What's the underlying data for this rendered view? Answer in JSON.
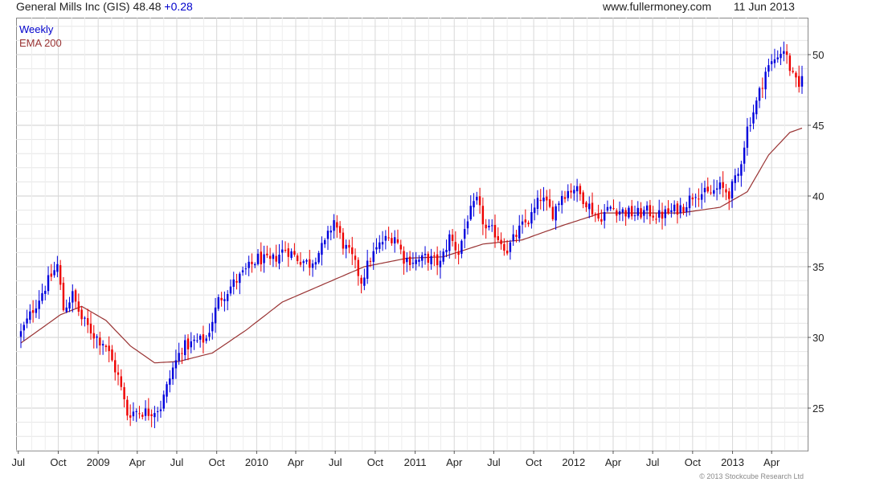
{
  "header": {
    "company": "General Mills Inc (GIS)",
    "price": "48.48",
    "change": "+0.28",
    "site": "www.fullermoney.com",
    "date": "11 Jun 2013"
  },
  "legend": {
    "interval": "Weekly",
    "ema": "EMA 200"
  },
  "footer": "© 2013 Stockcube Research Ltd",
  "colors": {
    "up": "#0000dd",
    "down": "#ee0000",
    "ema": "#993333",
    "grid": "#e6e6e6",
    "axis": "#555555"
  },
  "chart_data": {
    "type": "candlestick",
    "interval": "weekly",
    "x_range": [
      "2008-07-07",
      "2013-06-10"
    ],
    "ylim": [
      22,
      52
    ],
    "y_ticks": [
      25,
      30,
      35,
      40,
      45,
      50
    ],
    "x_tick_labels": [
      "Jul",
      "Oct",
      "2009",
      "Apr",
      "Jul",
      "Oct",
      "2010",
      "Apr",
      "Jul",
      "Oct",
      "2011",
      "Apr",
      "Jul",
      "Oct",
      "2012",
      "Apr",
      "Jul",
      "Oct",
      "2013",
      "Apr"
    ],
    "x_tick_dates": [
      "2008-07-01",
      "2008-10-01",
      "2009-01-01",
      "2009-04-01",
      "2009-07-01",
      "2009-10-01",
      "2010-01-01",
      "2010-04-01",
      "2010-07-01",
      "2010-10-01",
      "2011-01-01",
      "2011-04-01",
      "2011-07-01",
      "2011-10-01",
      "2012-01-01",
      "2012-04-01",
      "2012-07-01",
      "2012-10-01",
      "2013-01-01",
      "2013-04-01"
    ],
    "close_keypoints": [
      [
        "2008-07-07",
        30.3
      ],
      [
        "2008-08-04",
        32.0
      ],
      [
        "2008-09-01",
        33.6
      ],
      [
        "2008-09-29",
        35.1
      ],
      [
        "2008-10-13",
        32.0
      ],
      [
        "2008-11-03",
        33.0
      ],
      [
        "2008-11-24",
        31.3
      ],
      [
        "2008-12-22",
        30.2
      ],
      [
        "2009-01-19",
        29.4
      ],
      [
        "2009-02-16",
        27.2
      ],
      [
        "2009-03-09",
        24.6
      ],
      [
        "2009-03-30",
        24.8
      ],
      [
        "2009-04-27",
        24.7
      ],
      [
        "2009-05-25",
        25.1
      ],
      [
        "2009-06-22",
        27.8
      ],
      [
        "2009-07-13",
        29.3
      ],
      [
        "2009-08-10",
        29.6
      ],
      [
        "2009-09-07",
        29.9
      ],
      [
        "2009-10-05",
        32.6
      ],
      [
        "2009-11-02",
        33.6
      ],
      [
        "2009-12-07",
        34.7
      ],
      [
        "2010-01-04",
        35.6
      ],
      [
        "2010-02-01",
        35.3
      ],
      [
        "2010-03-08",
        36.3
      ],
      [
        "2010-04-05",
        35.6
      ],
      [
        "2010-05-03",
        35.2
      ],
      [
        "2010-06-07",
        36.6
      ],
      [
        "2010-06-28",
        38.3
      ],
      [
        "2010-07-19",
        36.6
      ],
      [
        "2010-08-09",
        35.6
      ],
      [
        "2010-08-30",
        34.0
      ],
      [
        "2010-09-20",
        35.6
      ],
      [
        "2010-10-18",
        36.8
      ],
      [
        "2010-11-15",
        37.2
      ],
      [
        "2010-12-06",
        35.6
      ],
      [
        "2011-01-03",
        35.4
      ],
      [
        "2011-01-31",
        35.6
      ],
      [
        "2011-02-28",
        35.2
      ],
      [
        "2011-03-21",
        37.1
      ],
      [
        "2011-04-11",
        36.0
      ],
      [
        "2011-05-02",
        38.5
      ],
      [
        "2011-05-23",
        39.6
      ],
      [
        "2011-06-13",
        37.6
      ],
      [
        "2011-07-04",
        37.4
      ],
      [
        "2011-08-01",
        36.2
      ],
      [
        "2011-08-29",
        37.6
      ],
      [
        "2011-09-26",
        38.6
      ],
      [
        "2011-10-17",
        39.9
      ],
      [
        "2011-11-14",
        38.8
      ],
      [
        "2011-12-05",
        40.1
      ],
      [
        "2012-01-02",
        40.6
      ],
      [
        "2012-01-30",
        39.6
      ],
      [
        "2012-02-27",
        38.4
      ],
      [
        "2012-03-26",
        39.2
      ],
      [
        "2012-04-23",
        38.9
      ],
      [
        "2012-05-21",
        38.7
      ],
      [
        "2012-06-18",
        38.9
      ],
      [
        "2012-07-16",
        38.6
      ],
      [
        "2012-08-13",
        38.9
      ],
      [
        "2012-09-10",
        39.3
      ],
      [
        "2012-10-08",
        40.3
      ],
      [
        "2012-11-05",
        40.1
      ],
      [
        "2012-12-03",
        40.6
      ],
      [
        "2012-12-24",
        40.2
      ],
      [
        "2013-01-14",
        41.5
      ],
      [
        "2013-02-04",
        44.8
      ],
      [
        "2013-02-25",
        46.6
      ],
      [
        "2013-03-18",
        48.8
      ],
      [
        "2013-04-08",
        49.7
      ],
      [
        "2013-04-29",
        50.4
      ],
      [
        "2013-05-20",
        48.4
      ],
      [
        "2013-06-03",
        47.6
      ],
      [
        "2013-06-10",
        48.48
      ]
    ],
    "ema200_keypoints": [
      [
        "2008-07-07",
        29.6
      ],
      [
        "2008-10-06",
        31.6
      ],
      [
        "2008-11-24",
        32.2
      ],
      [
        "2009-01-19",
        31.2
      ],
      [
        "2009-03-16",
        29.4
      ],
      [
        "2009-05-11",
        28.2
      ],
      [
        "2009-07-06",
        28.3
      ],
      [
        "2009-09-21",
        28.9
      ],
      [
        "2009-12-07",
        30.5
      ],
      [
        "2010-03-01",
        32.5
      ],
      [
        "2010-06-07",
        33.8
      ],
      [
        "2010-09-06",
        35.0
      ],
      [
        "2010-12-13",
        35.6
      ],
      [
        "2011-03-07",
        35.7
      ],
      [
        "2011-06-06",
        36.6
      ],
      [
        "2011-09-05",
        36.9
      ],
      [
        "2011-12-05",
        37.9
      ],
      [
        "2012-03-05",
        38.8
      ],
      [
        "2012-06-04",
        38.8
      ],
      [
        "2012-09-03",
        38.8
      ],
      [
        "2012-12-03",
        39.2
      ],
      [
        "2013-02-04",
        40.3
      ],
      [
        "2013-03-25",
        42.9
      ],
      [
        "2013-05-13",
        44.5
      ],
      [
        "2013-06-10",
        44.8
      ]
    ]
  }
}
